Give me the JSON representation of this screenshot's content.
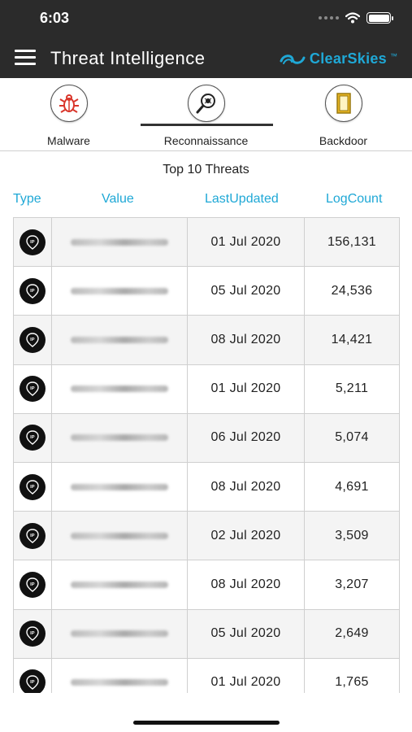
{
  "status_bar": {
    "time": "6:03"
  },
  "app_bar": {
    "title": "Threat Intelligence",
    "brand": "ClearSkies",
    "brand_tm": "™"
  },
  "tabs": [
    {
      "label": "Malware",
      "icon": "bug-icon",
      "active": false
    },
    {
      "label": "Reconnaissance",
      "icon": "magnifier-icon",
      "active": true
    },
    {
      "label": "Backdoor",
      "icon": "door-icon",
      "active": false
    }
  ],
  "section_title": "Top 10 Threats",
  "columns": {
    "type": "Type",
    "value": "Value",
    "last_updated": "LastUpdated",
    "log_count": "LogCount"
  },
  "rows": [
    {
      "type_icon": "ip-icon",
      "type_text": "IP",
      "last_updated": "01 Jul 2020",
      "log_count": "156,131"
    },
    {
      "type_icon": "ip-icon",
      "type_text": "IP",
      "last_updated": "05 Jul 2020",
      "log_count": "24,536"
    },
    {
      "type_icon": "ip-icon",
      "type_text": "IP",
      "last_updated": "08 Jul 2020",
      "log_count": "14,421"
    },
    {
      "type_icon": "ip-icon",
      "type_text": "IP",
      "last_updated": "01 Jul 2020",
      "log_count": "5,211"
    },
    {
      "type_icon": "ip-icon",
      "type_text": "IP",
      "last_updated": "06 Jul 2020",
      "log_count": "5,074"
    },
    {
      "type_icon": "ip-icon",
      "type_text": "IP",
      "last_updated": "08 Jul 2020",
      "log_count": "4,691"
    },
    {
      "type_icon": "ip-icon",
      "type_text": "IP",
      "last_updated": "02 Jul 2020",
      "log_count": "3,509"
    },
    {
      "type_icon": "ip-icon",
      "type_text": "IP",
      "last_updated": "08 Jul 2020",
      "log_count": "3,207"
    },
    {
      "type_icon": "ip-icon",
      "type_text": "IP",
      "last_updated": "05 Jul 2020",
      "log_count": "2,649"
    },
    {
      "type_icon": "ip-icon",
      "type_text": "IP",
      "last_updated": "01 Jul 2020",
      "log_count": "1,765"
    }
  ],
  "colors": {
    "header_bg": "#2b2b2b",
    "accent": "#1fa8d6",
    "bug_red": "#d9362b",
    "door_gold": "#e6b422"
  }
}
